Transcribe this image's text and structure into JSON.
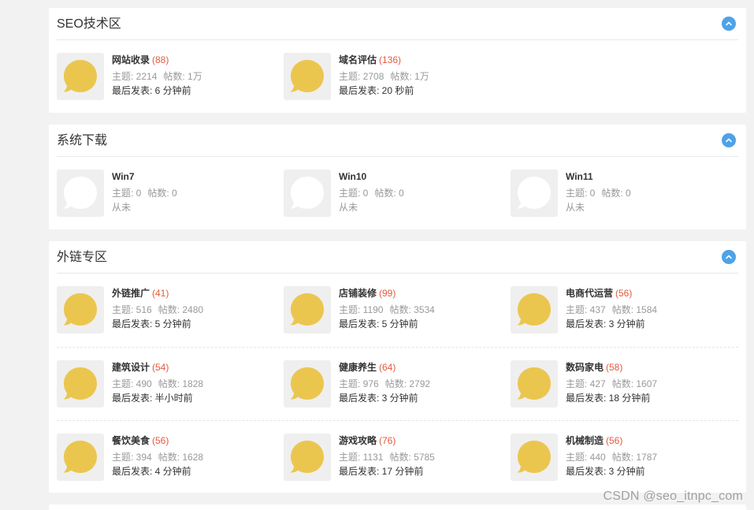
{
  "colors": {
    "background": "#f2f2f2",
    "card": "#ffffff",
    "accent": "#4ea2e8",
    "count": "#e4593d",
    "icon_active": "#ebc64f",
    "icon_inactive": "#ffffff"
  },
  "sections": [
    {
      "title": "SEO技术区",
      "collapse_icon": "chevron-up-icon",
      "forums": [
        {
          "name": "网站收录",
          "count": "(88)",
          "threads": "主题: 2214",
          "posts": "帖数: 1万",
          "last": "最后发表: 6 分钟前",
          "active": true
        },
        {
          "name": "域名评估",
          "count": "(136)",
          "threads": "主题: 2708",
          "posts": "帖数: 1万",
          "last": "最后发表: 20 秒前",
          "active": true
        }
      ]
    },
    {
      "title": "系统下载",
      "collapse_icon": "chevron-up-icon",
      "forums": [
        {
          "name": "Win7",
          "count": "",
          "threads": "主题: 0",
          "posts": "帖数: 0",
          "last": "从未",
          "active": false
        },
        {
          "name": "Win10",
          "count": "",
          "threads": "主题: 0",
          "posts": "帖数: 0",
          "last": "从未",
          "active": false
        },
        {
          "name": "Win11",
          "count": "",
          "threads": "主题: 0",
          "posts": "帖数: 0",
          "last": "从未",
          "active": false
        }
      ]
    },
    {
      "title": "外链专区",
      "collapse_icon": "chevron-up-icon",
      "forums": [
        {
          "name": "外链推广",
          "count": "(41)",
          "threads": "主题: 516",
          "posts": "帖数: 2480",
          "last": "最后发表: 5 分钟前",
          "active": true
        },
        {
          "name": "店铺装修",
          "count": "(99)",
          "threads": "主题: 1190",
          "posts": "帖数: 3534",
          "last": "最后发表: 5 分钟前",
          "active": true
        },
        {
          "name": "电商代运营",
          "count": "(56)",
          "threads": "主题: 437",
          "posts": "帖数: 1584",
          "last": "最后发表: 3 分钟前",
          "active": true
        },
        {
          "name": "建筑设计",
          "count": "(54)",
          "threads": "主题: 490",
          "posts": "帖数: 1828",
          "last": "最后发表: 半小时前",
          "active": true
        },
        {
          "name": "健康养生",
          "count": "(64)",
          "threads": "主题: 976",
          "posts": "帖数: 2792",
          "last": "最后发表: 3 分钟前",
          "active": true
        },
        {
          "name": "数码家电",
          "count": "(58)",
          "threads": "主题: 427",
          "posts": "帖数: 1607",
          "last": "最后发表: 18 分钟前",
          "active": true
        },
        {
          "name": "餐饮美食",
          "count": "(56)",
          "threads": "主题: 394",
          "posts": "帖数: 1628",
          "last": "最后发表: 4 分钟前",
          "active": true
        },
        {
          "name": "游戏攻略",
          "count": "(76)",
          "threads": "主题: 1131",
          "posts": "帖数: 5785",
          "last": "最后发表: 17 分钟前",
          "active": true
        },
        {
          "name": "机械制造",
          "count": "(56)",
          "threads": "主题: 440",
          "posts": "帖数: 1787",
          "last": "最后发表: 3 分钟前",
          "active": true
        }
      ]
    }
  ],
  "watermark": "CSDN @seo_itnpc_com"
}
